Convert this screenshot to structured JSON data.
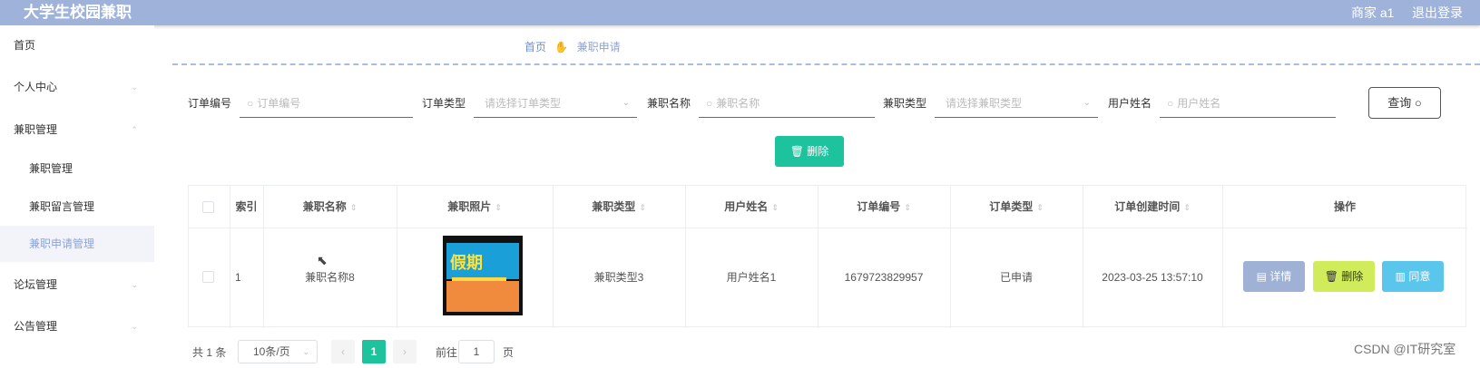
{
  "header": {
    "title": "大学生校园兼职",
    "user": "商家 a1",
    "logout": "退出登录"
  },
  "sidebar": {
    "items": [
      {
        "label": "首页"
      },
      {
        "label": "个人中心",
        "chevron": "⌄"
      },
      {
        "label": "兼职管理",
        "chevron": "⌃"
      },
      {
        "label": "兼职管理"
      },
      {
        "label": "兼职留言管理"
      },
      {
        "label": "兼职申请管理"
      },
      {
        "label": "论坛管理",
        "chevron": "⌄"
      },
      {
        "label": "公告管理",
        "chevron": "⌄"
      }
    ]
  },
  "breadcrumb": {
    "home": "首页",
    "current": "兼职申请"
  },
  "filters": {
    "order_no": {
      "label": "订单编号",
      "placeholder": "订单编号"
    },
    "order_type": {
      "label": "订单类型",
      "placeholder": "请选择订单类型"
    },
    "job_name": {
      "label": "兼职名称",
      "placeholder": "兼职名称"
    },
    "job_type": {
      "label": "兼职类型",
      "placeholder": "请选择兼职类型"
    },
    "user_name": {
      "label": "用户姓名",
      "placeholder": "用户姓名"
    },
    "search_button": "查询"
  },
  "actions": {
    "delete_label": "删除"
  },
  "table": {
    "headers": [
      "索引",
      "兼职名称",
      "兼职照片",
      "兼职类型",
      "用户姓名",
      "订单编号",
      "订单类型",
      "订单创建时间",
      "操作"
    ],
    "rows": [
      {
        "index": "1",
        "job_name": "兼职名称8",
        "job_photo_text": "假期",
        "job_type": "兼职类型3",
        "user_name": "用户姓名1",
        "order_no": "1679723829957",
        "order_type": "已申请",
        "created": "2023-03-25 13:57:10",
        "btn_detail": "详情",
        "btn_delete": "删除",
        "btn_agree": "同意"
      }
    ]
  },
  "pagination": {
    "total": "共 1 条",
    "page_size": "10条/页",
    "current_page": "1",
    "goto_label": "前往",
    "goto_value": "1",
    "page_suffix": "页"
  },
  "watermark": "CSDN @IT研究室",
  "colors": {
    "header": "#9eb2da",
    "accent": "#1cc39c",
    "detail": "#9fb1d5",
    "delete": "#d1ec5a",
    "agree": "#5bc6ec"
  }
}
